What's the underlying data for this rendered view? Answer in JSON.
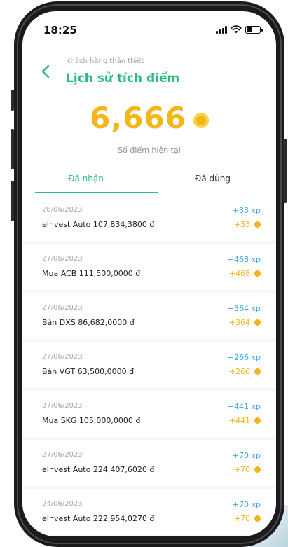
{
  "status_bar": {
    "time": "18:25"
  },
  "header": {
    "subtitle": "Khách hàng thân thiết",
    "title": "Lịch sử tích điểm"
  },
  "summary": {
    "points": "6,666",
    "points_label": "Số điểm hiện tại"
  },
  "tabs": [
    {
      "label": "Đã nhận",
      "active": true
    },
    {
      "label": "Đã dùng",
      "active": false
    }
  ],
  "history": [
    {
      "date": "28/06/2023",
      "desc": "eInvest Auto 107,834,3800 đ",
      "xp": "+33 xp",
      "points": "+33"
    },
    {
      "date": "27/06/2023",
      "desc": "Mua ACB 111,500,0000 đ",
      "xp": "+468 xp",
      "points": "+468"
    },
    {
      "date": "27/06/2023",
      "desc": "Bán DXS 86,682,0000 đ",
      "xp": "+364 xp",
      "points": "+364"
    },
    {
      "date": "27/06/2023",
      "desc": "Bán VGT 63,500,0000 đ",
      "xp": "+266 xp",
      "points": "+266"
    },
    {
      "date": "27/06/2023",
      "desc": "Mua SKG 105,000,0000 đ",
      "xp": "+441 xp",
      "points": "+441"
    },
    {
      "date": "27/06/2023",
      "desc": "eInvest Auto 224,407,6020 đ",
      "xp": "+70 xp",
      "points": "+70"
    },
    {
      "date": "24/06/2023",
      "desc": "eInvest Auto 222,954,0270 đ",
      "xp": "+70 xp",
      "points": "+70"
    }
  ],
  "colors": {
    "accent_green": "#2ebc7e",
    "points_gold": "#f4b619",
    "xp_blue": "#3aa7e6"
  },
  "icons": {
    "back": "chevron-left-icon",
    "coin": "coin-icon",
    "signal": "signal-icon",
    "wifi": "wifi-icon",
    "battery": "battery-icon"
  }
}
